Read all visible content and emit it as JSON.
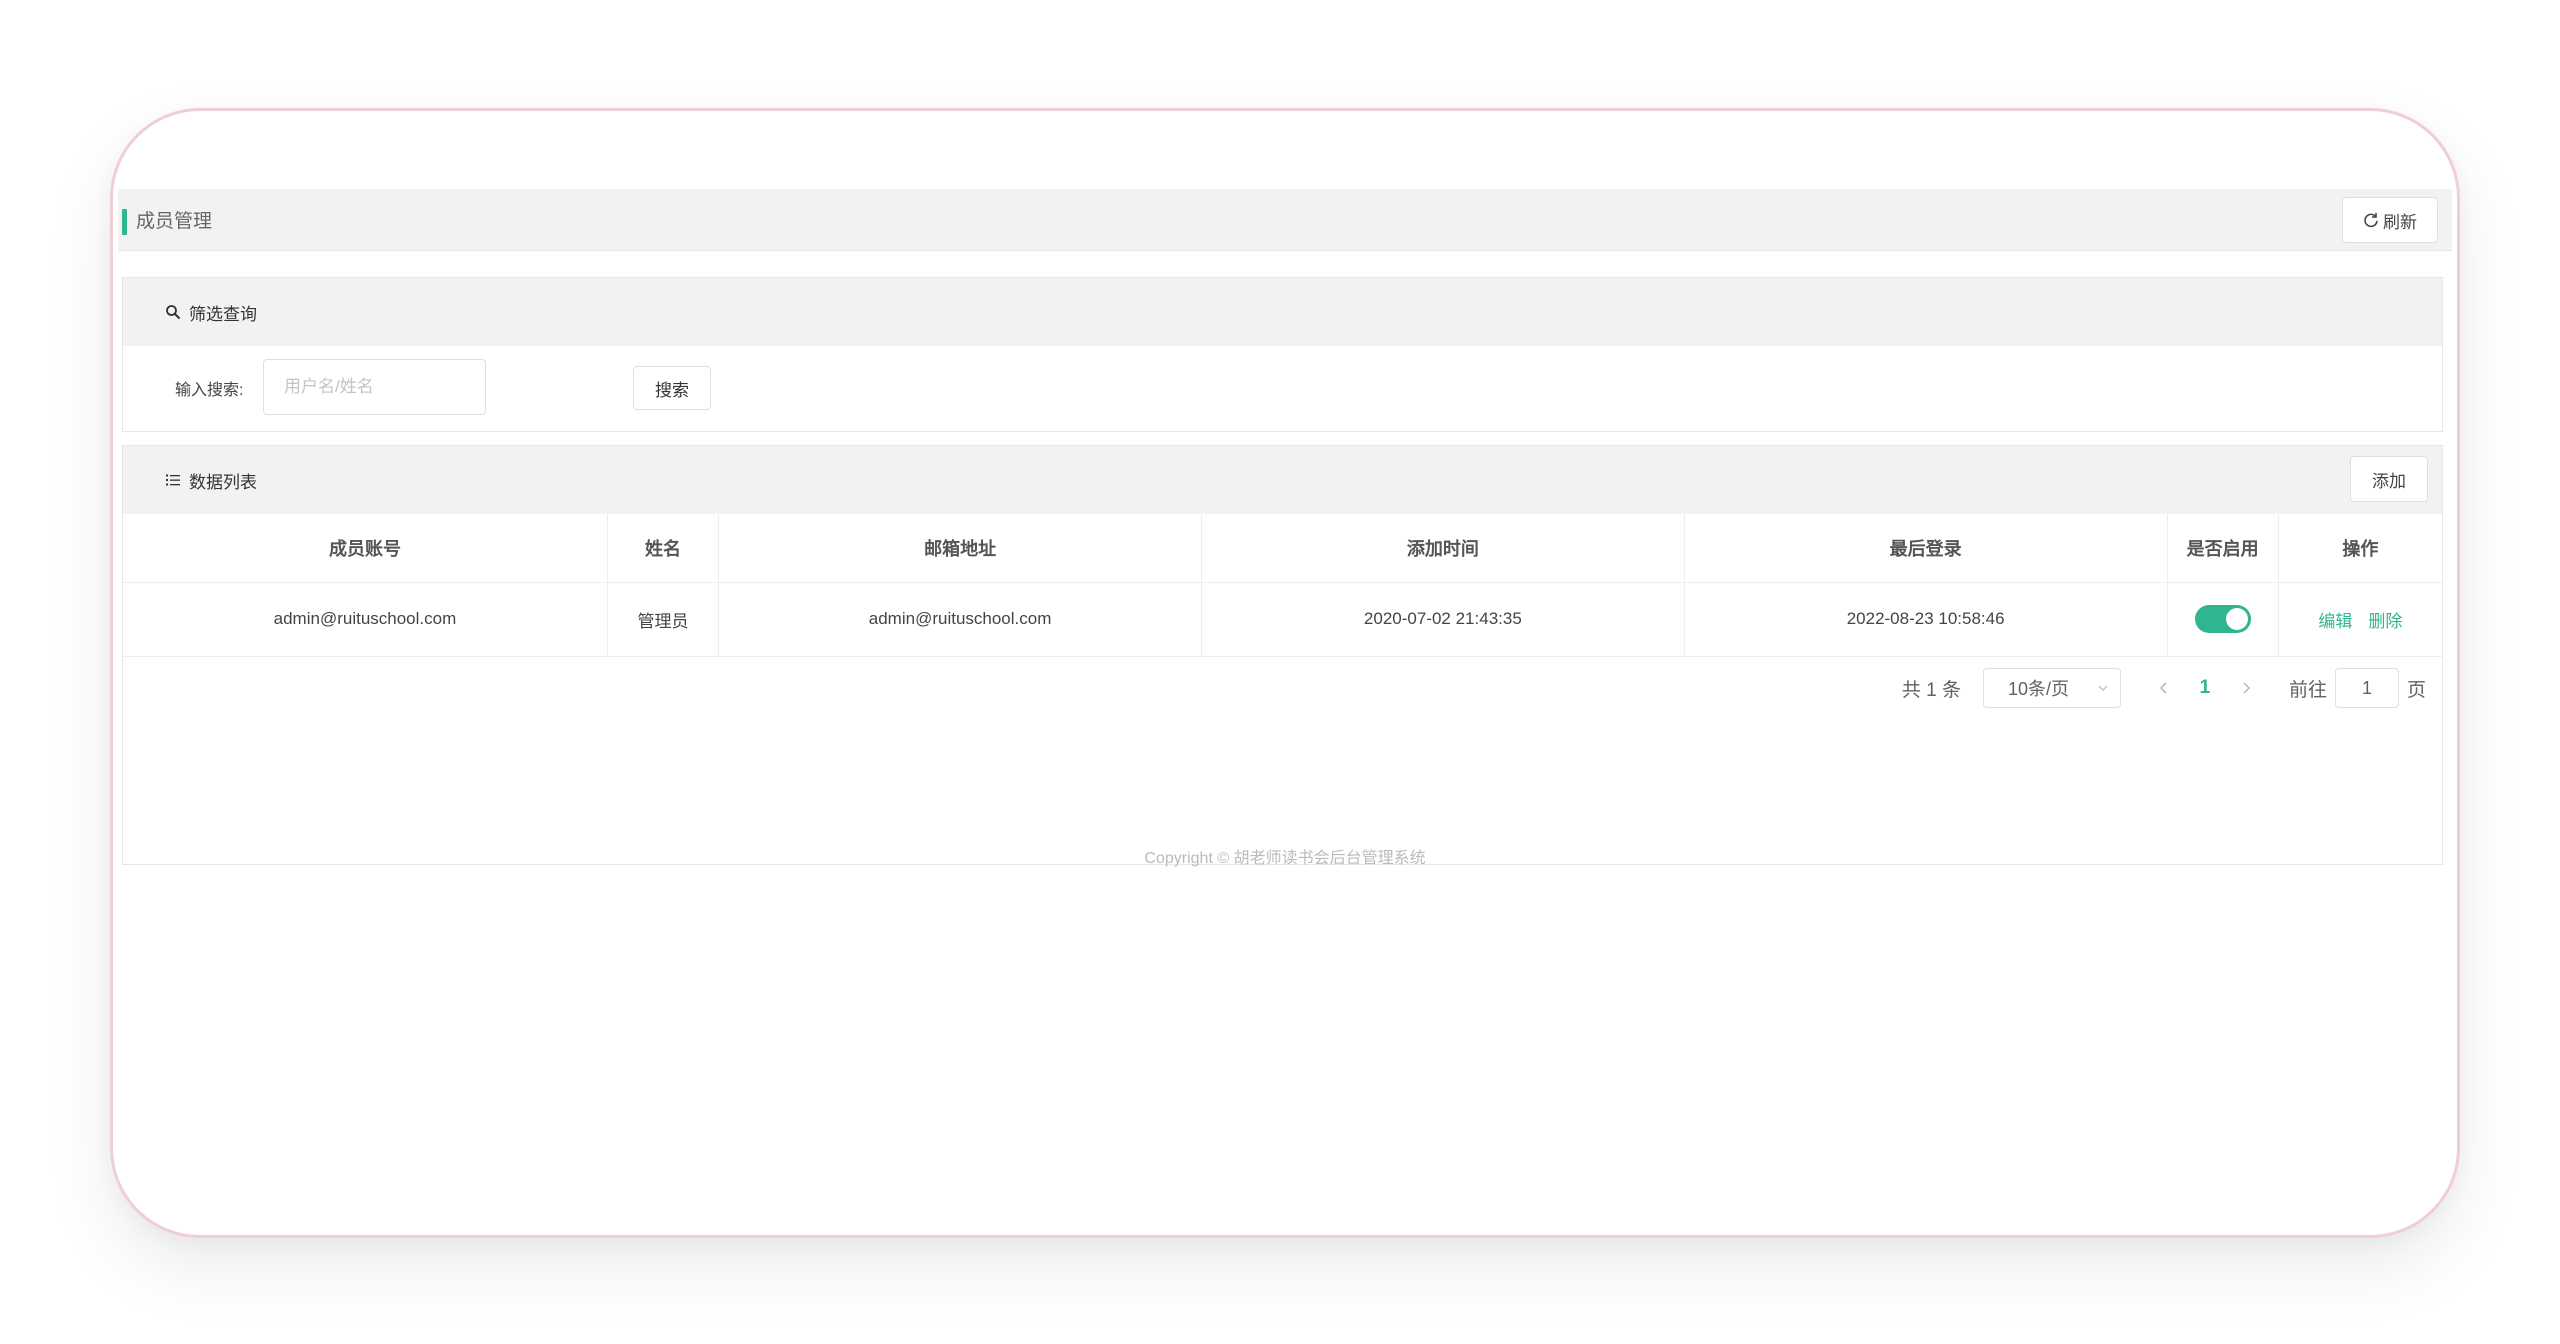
{
  "header": {
    "title": "成员管理",
    "refresh_label": "刷新"
  },
  "filter": {
    "title": "筛选查询",
    "search_label": "输入搜索:",
    "search_placeholder": "用户名/姓名",
    "search_button": "搜索"
  },
  "list": {
    "title": "数据列表",
    "add_button": "添加",
    "columns": [
      "成员账号",
      "姓名",
      "邮箱地址",
      "添加时间",
      "最后登录",
      "是否启用",
      "操作"
    ],
    "rows": [
      {
        "account": "admin@ruituschool.com",
        "name": "管理员",
        "email": "admin@ruituschool.com",
        "created": "2020-07-02 21:43:35",
        "last_login": "2022-08-23 10:58:46",
        "enabled": true,
        "edit_label": "编辑",
        "delete_label": "删除"
      }
    ]
  },
  "pagination": {
    "total_text": "共 1 条",
    "page_size": "10条/页",
    "current_page": "1",
    "goto_label": "前往",
    "goto_value": "1",
    "page_suffix": "页"
  },
  "footer": {
    "copyright": "Copyright © 胡老师读书会后台管理系统"
  },
  "colors": {
    "accent": "#2fb58f",
    "header_bg": "#f2f2f2",
    "device_border": "#efcfd3"
  }
}
